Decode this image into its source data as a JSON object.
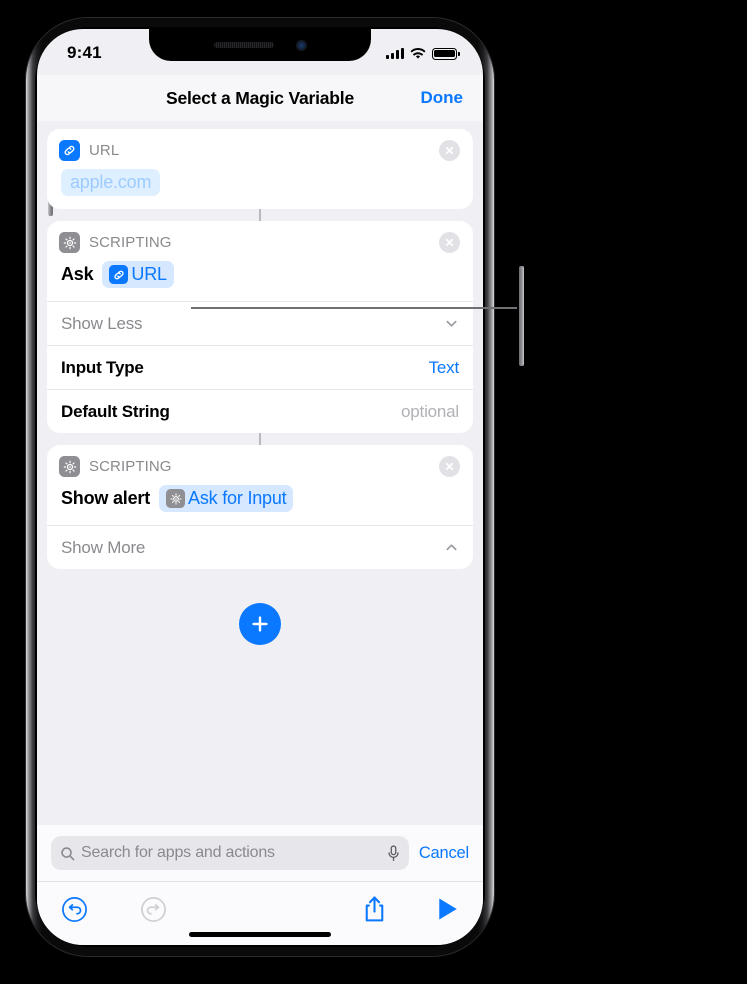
{
  "status_bar": {
    "time": "9:41",
    "icons": [
      "cellular-signal-icon",
      "wifi-icon",
      "battery-icon"
    ]
  },
  "nav": {
    "title": "Select a Magic Variable",
    "done_label": "Done"
  },
  "colors": {
    "accent_blue": "#0a78ff",
    "token_fill": "#d6e8ff",
    "canvas_bg": "#efeff4",
    "card_bg": "#ffffff",
    "muted_text": "#8a8a8e"
  },
  "cards": [
    {
      "header_label": "URL",
      "header_icon": "link-icon",
      "header_icon_color": "blue",
      "clear_icon": "clear-circle-icon",
      "body": {
        "prefix": "",
        "token": {
          "label": "apple.com",
          "icon": null,
          "style": "soft"
        }
      },
      "rows": []
    },
    {
      "header_label": "SCRIPTING",
      "header_icon": "gear-icon",
      "header_icon_color": "gray",
      "clear_icon": "clear-circle-icon",
      "body": {
        "prefix": "Ask",
        "token": {
          "label": "URL",
          "icon": "link-icon",
          "style": "normal"
        }
      },
      "rows": [
        {
          "label": "Show Less",
          "label_muted": true,
          "value": null,
          "chevron": "chevron-down-icon"
        },
        {
          "label": "Input Type",
          "label_muted": false,
          "value": "Text",
          "value_placeholder": false,
          "chevron": null
        },
        {
          "label": "Default String",
          "label_muted": false,
          "value": "optional",
          "value_placeholder": true,
          "chevron": null
        }
      ]
    },
    {
      "header_label": "SCRIPTING",
      "header_icon": "gear-icon",
      "header_icon_color": "gray",
      "clear_icon": "clear-circle-icon",
      "body": {
        "prefix": "Show alert",
        "token": {
          "label": "Ask for Input",
          "icon": "gear-icon",
          "style": "normal"
        }
      },
      "rows": [
        {
          "label": "Show More",
          "label_muted": true,
          "value": null,
          "chevron": "chevron-up-icon"
        }
      ]
    }
  ],
  "add_button": {
    "icon": "plus-icon"
  },
  "search": {
    "placeholder": "Search for apps and actions",
    "value": "",
    "search_icon": "search-icon",
    "mic_icon": "microphone-icon",
    "cancel_label": "Cancel"
  },
  "toolbar": {
    "undo_icon": "undo-icon",
    "redo_icon": "redo-icon",
    "share_icon": "share-icon",
    "play_icon": "play-icon"
  }
}
